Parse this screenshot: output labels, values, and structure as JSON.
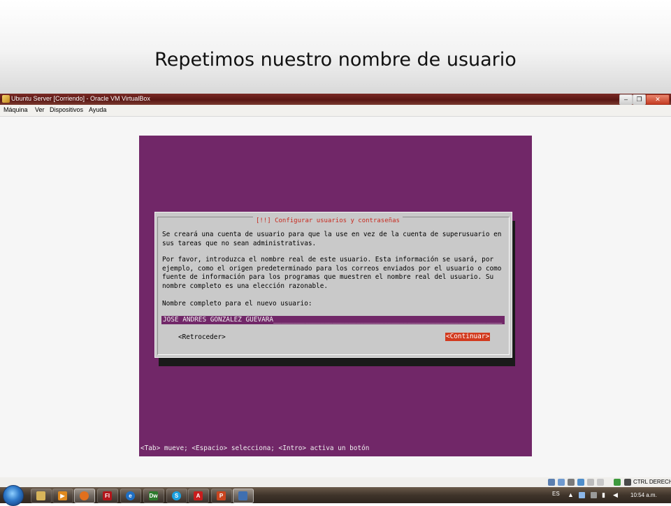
{
  "slide": {
    "title": "Repetimos nuestro nombre de usuario"
  },
  "window": {
    "title": "Ubuntu Server [Corriendo] - Oracle VM VirtualBox",
    "controls": {
      "minimize": "–",
      "restore": "❐",
      "close": "✕"
    }
  },
  "menu": [
    "Máquina",
    "Ver",
    "Dispositivos",
    "Ayuda"
  ],
  "dialog": {
    "title": "[!!] Configurar usuarios y contraseñas",
    "para1": "Se creará una cuenta de usuario para que la use en vez de la cuenta de superusuario en\nsus tareas que no sean administrativas.",
    "para2": "Por favor, introduzca el nombre real de este usuario. Esta información se usará, por\nejemplo, como el origen predeterminado para los correos enviados por el usuario o como\nfuente de información para los programas que muestren el nombre real del usuario. Su\nnombre completo es una elección razonable.",
    "prompt": "Nombre completo para el nuevo usuario:",
    "input_value": "JOSE ANDRES GONZALEZ GUEVARA",
    "back_button": "<Retroceder>",
    "continue_button": "<Continuar>"
  },
  "vm_status_line": "<Tab> mueve; <Espacio> selecciona; <Intro> activa un botón",
  "vb_status": {
    "host_key": "CTRL DERECHA"
  },
  "taskbar": {
    "apps": [
      "explorer",
      "media-player",
      "firefox",
      "flash",
      "internet-explorer",
      "dreamweaver",
      "skype",
      "acrobat",
      "powerpoint",
      "virtualbox"
    ],
    "language": "ES",
    "time": "10:54 a.m."
  },
  "colors": {
    "vm_background": "#712768",
    "dialog_background": "#c9c9c9",
    "title_red": "#c8281d",
    "button_red": "#d23a1e"
  }
}
